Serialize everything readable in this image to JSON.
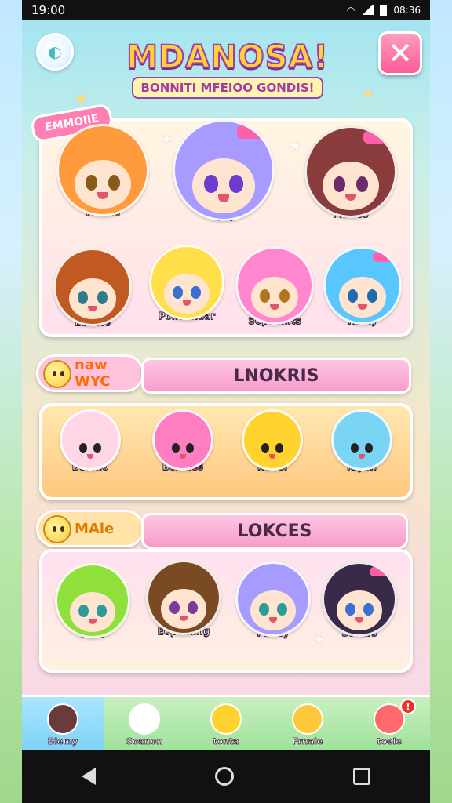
{
  "statusbar": {
    "time": "19:00",
    "right_text": "08:36"
  },
  "header": {
    "title": "MDANOSA!",
    "subtitle": "BONNITI MFEIOO GONDIS!",
    "close_symbol": "✕"
  },
  "featured": {
    "badge": "EMMOIIE",
    "characters": [
      {
        "name": "Meoos",
        "hair": "#ff9a3d",
        "eye": "#8a5a1a"
      },
      {
        "name": "Cat",
        "hair": "#a89bff",
        "eye": "#6b3ccf"
      },
      {
        "name": "Matios",
        "hair": "#8a3b3b",
        "eye": "#6b2c6b"
      },
      {
        "name": "Ebnoie",
        "hair": "#c05a22",
        "eye": "#2f7d8a"
      },
      {
        "name": "Poiloenaar",
        "hair": "#ffe04a",
        "eye": "#3b6fd1"
      },
      {
        "name": "Sopaanits",
        "hair": "#ff86cf",
        "eye": "#b1761d"
      },
      {
        "name": "Rainy",
        "hair": "#5ac6ff",
        "eye": "#1f6bb1"
      }
    ]
  },
  "section1": {
    "chip": "naw WYC",
    "title": "LNOKRIS",
    "characters": [
      {
        "name": "Benmo",
        "color": "#ffd6e6"
      },
      {
        "name": "Bcinaes",
        "color": "#ff7ec1"
      },
      {
        "name": "Navel",
        "color": "#ffd22e"
      },
      {
        "name": "Kiyen",
        "color": "#7ad5f5"
      }
    ]
  },
  "section2": {
    "chip": "MAle",
    "title": "LOKCES",
    "characters": [
      {
        "name": "Bers",
        "hair": "#8fe03a",
        "eye": "#2e9b9b"
      },
      {
        "name": "Eopealing",
        "hair": "#7a4a22",
        "eye": "#7a3c9b"
      },
      {
        "name": "Paney",
        "hair": "#a79bff",
        "eye": "#2e9b9b"
      },
      {
        "name": "Scoars",
        "hair": "#3a2a4a",
        "eye": "#3b6fd1"
      }
    ]
  },
  "bottom_nav": {
    "items": [
      {
        "label": "Blemy",
        "color": "#6b3b3b"
      },
      {
        "label": "Soanon",
        "color": "#ffffff"
      },
      {
        "label": "tonta",
        "color": "#ffd22e"
      },
      {
        "label": "Frnale",
        "color": "#ffc83a"
      },
      {
        "label": "toele",
        "color": "#ff6b6b"
      }
    ],
    "notification_count": "!"
  }
}
